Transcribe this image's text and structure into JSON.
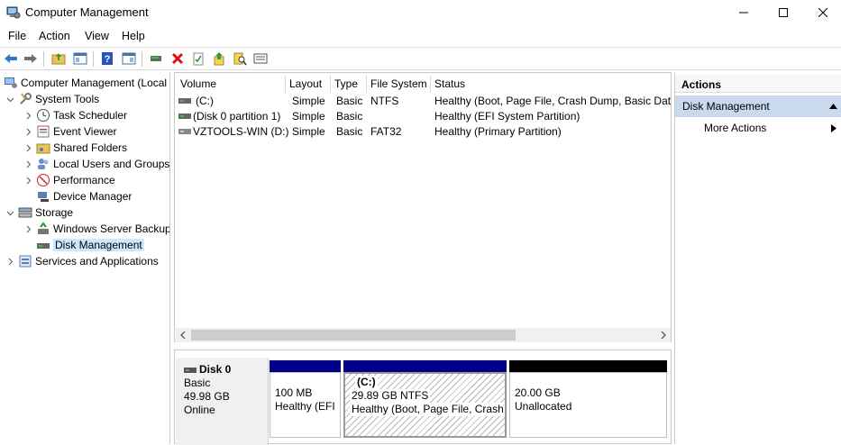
{
  "window": {
    "title": "Computer Management"
  },
  "menu": [
    "File",
    "Action",
    "View",
    "Help"
  ],
  "toolbar": {
    "icons": [
      "back-icon",
      "forward-icon",
      "up-folder-icon",
      "show-hide-tree-icon",
      "help-icon",
      "show-hide-action-pane-icon",
      "connect-icon",
      "delete-icon",
      "properties-icon",
      "export-icon",
      "search-icon",
      "list-icon"
    ]
  },
  "tree": {
    "root": "Computer Management (Local",
    "system_tools": "System Tools",
    "task_scheduler": "Task Scheduler",
    "event_viewer": "Event Viewer",
    "shared_folders": "Shared Folders",
    "local_users": "Local Users and Groups",
    "performance": "Performance",
    "device_manager": "Device Manager",
    "storage": "Storage",
    "wsb": "Windows Server Backup",
    "disk_mgmt": "Disk Management",
    "services_apps": "Services and Applications"
  },
  "volumes": {
    "columns": [
      "Volume",
      "Layout",
      "Type",
      "File System",
      "Status"
    ],
    "rows": [
      {
        "volume": "(C:)",
        "layout": "Simple",
        "type": "Basic",
        "fs": "NTFS",
        "status": "Healthy (Boot, Page File, Crash Dump, Basic Data"
      },
      {
        "volume": "(Disk 0 partition 1)",
        "layout": "Simple",
        "type": "Basic",
        "fs": "",
        "status": "Healthy (EFI System Partition)"
      },
      {
        "volume": "VZTOOLS-WIN (D:)",
        "layout": "Simple",
        "type": "Basic",
        "fs": "FAT32",
        "status": "Healthy (Primary Partition)"
      }
    ]
  },
  "disk": {
    "name": "Disk 0",
    "type": "Basic",
    "size": "49.98 GB",
    "state": "Online",
    "partitions": [
      {
        "name": "",
        "size": "100 MB",
        "status": "Healthy (EFI"
      },
      {
        "name": "(C:)",
        "size": "29.89 GB NTFS",
        "status": "Healthy (Boot, Page File, Crash I"
      },
      {
        "name": "",
        "size": "20.00 GB",
        "status": "Unallocated"
      }
    ],
    "colors": {
      "primary": "#00008b",
      "unallocated": "#000000"
    }
  },
  "actions": {
    "header": "Actions",
    "group": "Disk Management",
    "more": "More Actions"
  }
}
